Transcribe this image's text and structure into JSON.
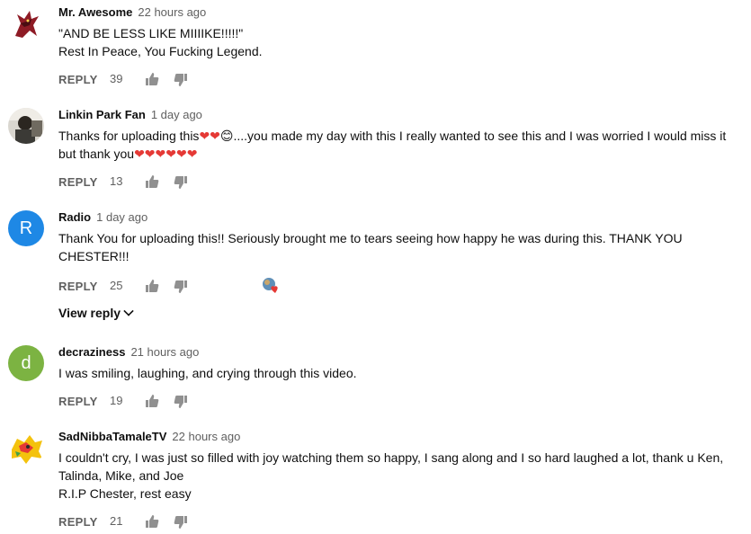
{
  "reply_label": "REPLY",
  "view_reply_label": "View reply",
  "comments": [
    {
      "author": "Mr. Awesome",
      "time": "22 hours ago",
      "lines": [
        "\"AND BE LESS LIKE MIIIIKE!!!!!\"",
        "Rest In Peace, You Fucking Legend."
      ],
      "likes": "39",
      "avatar": {
        "type": "image",
        "icon": "red-wolf-avatar-icon"
      }
    },
    {
      "author": "Linkin Park Fan",
      "time": "1 day ago",
      "lines": [
        "Thanks for uploading this❤❤😊....you made my day with this I really wanted to see this and I was worried I would miss it",
        "but thank you❤❤❤❤❤❤"
      ],
      "likes": "13",
      "avatar": {
        "type": "image",
        "icon": "photo-avatar-icon"
      }
    },
    {
      "author": "Radio",
      "time": "1 day ago",
      "lines": [
        "Thank You for uploading this!! Seriously brought me to tears seeing how happy he was during this. THANK YOU",
        "CHESTER!!!"
      ],
      "likes": "25",
      "avatar": {
        "type": "letter",
        "letter": "R",
        "color": "#1e88e5"
      }
    },
    {
      "author": "decraziness",
      "time": "21 hours ago",
      "lines": [
        "I was smiling, laughing, and crying through this video."
      ],
      "likes": "19",
      "avatar": {
        "type": "letter",
        "letter": "d",
        "color": "#7cb342"
      }
    },
    {
      "author": "SadNibbaTamaleTV",
      "time": "22 hours ago",
      "lines": [
        "I couldn't cry, I was just so filled with joy watching them so happy, I sang along and I so hard laughed a lot, thank u Ken,",
        "Talinda, Mike, and Joe",
        "R.I.P Chester, rest easy"
      ],
      "likes": "21",
      "avatar": {
        "type": "image",
        "icon": "cartoon-avatar-icon"
      }
    }
  ],
  "colors": {
    "heart": "#e53935",
    "meta": "#606060",
    "icon": "#909090"
  }
}
